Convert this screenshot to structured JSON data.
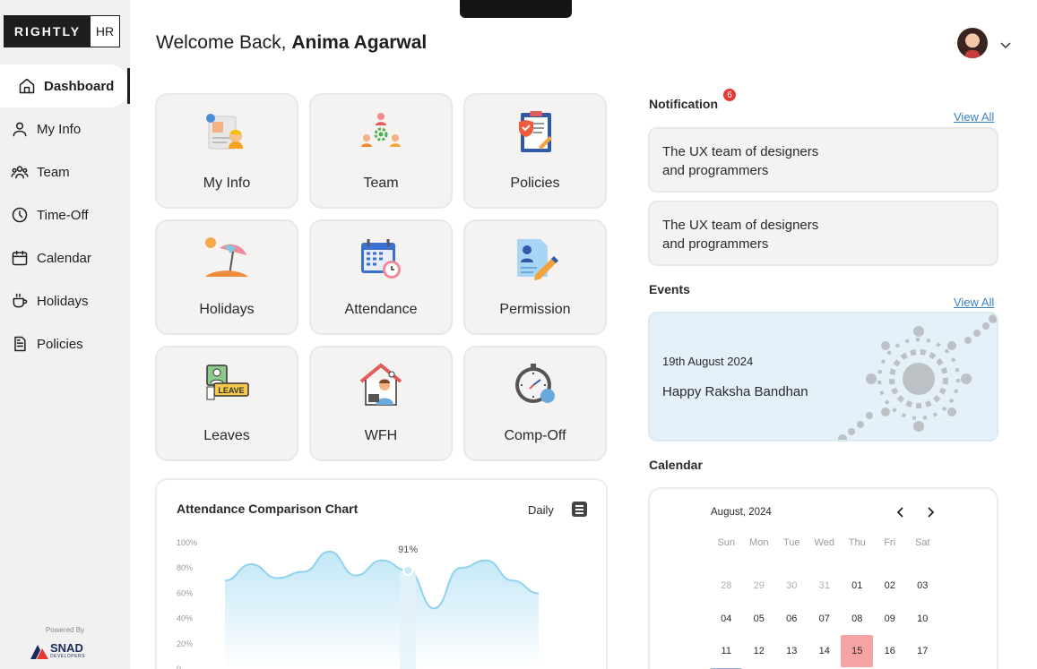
{
  "brand": {
    "main": "RIGHTLY",
    "sub": "HR"
  },
  "sidebar": {
    "items": [
      {
        "label": "Dashboard",
        "icon": "home-icon"
      },
      {
        "label": "My Info",
        "icon": "user-icon"
      },
      {
        "label": "Team",
        "icon": "team-icon"
      },
      {
        "label": "Time-Off",
        "icon": "clock-icon"
      },
      {
        "label": "Calendar",
        "icon": "calendar-icon"
      },
      {
        "label": "Holidays",
        "icon": "cup-icon"
      },
      {
        "label": "Policies",
        "icon": "document-icon"
      }
    ],
    "powered_by": "Powered By",
    "powered_brand": "SNAD",
    "powered_brand_sub": "DEVELOPERS"
  },
  "header": {
    "greeting": "Welcome Back,",
    "user_name": "Anima Agarwal"
  },
  "tiles": [
    {
      "label": "My Info",
      "icon": "profile-card-icon"
    },
    {
      "label": "Team",
      "icon": "team-network-icon"
    },
    {
      "label": "Policies",
      "icon": "clipboard-icon"
    },
    {
      "label": "Holidays",
      "icon": "beach-umbrella-icon"
    },
    {
      "label": "Attendance",
      "icon": "calendar-clock-icon"
    },
    {
      "label": "Permission",
      "icon": "document-pen-icon"
    },
    {
      "label": "Leaves",
      "icon": "leave-card-icon"
    },
    {
      "label": "WFH",
      "icon": "home-office-icon"
    },
    {
      "label": "Comp-Off",
      "icon": "stopwatch-icon"
    }
  ],
  "notification": {
    "title": "Notification",
    "count": "6",
    "view_all": "View All",
    "items": [
      {
        "line1": "The UX team of designers",
        "line2": "and programmers"
      },
      {
        "line1": "The UX team of designers",
        "line2": "and programmers"
      }
    ]
  },
  "events": {
    "title": "Events",
    "view_all": "View All",
    "date": "19th August 2024",
    "name": "Happy Raksha Bandhan"
  },
  "calendar": {
    "title": "Calendar",
    "month": "August, 2024",
    "weekdays": [
      "Sun",
      "Mon",
      "Tue",
      "Wed",
      "Thu",
      "Fri",
      "Sat"
    ],
    "days": [
      {
        "d": "28",
        "muted": true
      },
      {
        "d": "29",
        "muted": true
      },
      {
        "d": "30",
        "muted": true
      },
      {
        "d": "31",
        "muted": true
      },
      {
        "d": "01"
      },
      {
        "d": "02"
      },
      {
        "d": "03"
      },
      {
        "d": "04"
      },
      {
        "d": "05"
      },
      {
        "d": "06"
      },
      {
        "d": "07"
      },
      {
        "d": "08"
      },
      {
        "d": "09"
      },
      {
        "d": "10"
      },
      {
        "d": "11"
      },
      {
        "d": "12"
      },
      {
        "d": "13"
      },
      {
        "d": "14"
      },
      {
        "d": "15",
        "today": true
      },
      {
        "d": "16"
      },
      {
        "d": "17"
      },
      {
        "d": "",
        "selected": true
      }
    ],
    "today_color": "#f5a3a3",
    "selected_color": "#8eaee0"
  },
  "attendance_chart": {
    "title": "Attendance Comparison Chart",
    "period": "Daily",
    "highlight_label": "91%"
  },
  "chart_data": {
    "type": "area",
    "title": "Attendance Comparison Chart",
    "yticks": [
      "100%",
      "80%",
      "60%",
      "40%",
      "20%",
      "0"
    ],
    "ylim": [
      0,
      100
    ],
    "x": [
      0,
      1,
      2,
      3,
      4,
      5,
      6,
      7,
      8,
      9,
      10,
      11,
      12
    ],
    "values": [
      70,
      83,
      72,
      77,
      93,
      74,
      86,
      78,
      48,
      80,
      86,
      70,
      60
    ],
    "annotation": {
      "x": 7,
      "label": "91%"
    },
    "color": "#8fd3ef"
  }
}
